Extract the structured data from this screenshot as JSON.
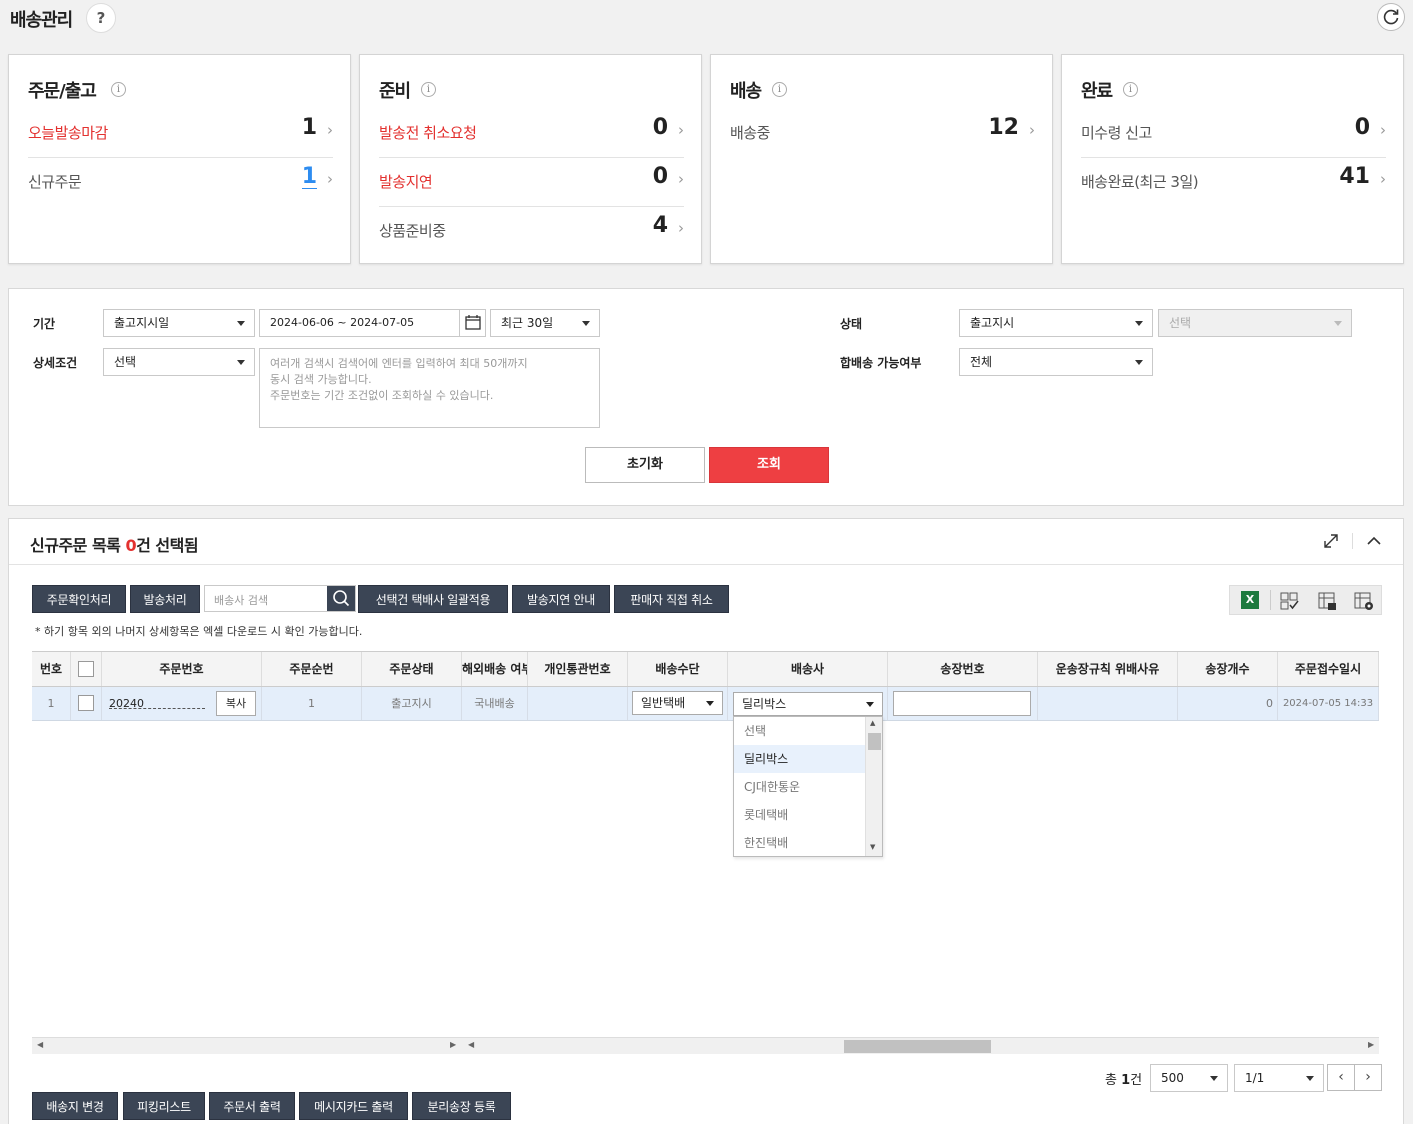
{
  "page": {
    "title": "배송관리",
    "help": "?"
  },
  "cards": [
    {
      "title": "주문/출고",
      "rows": [
        {
          "label": "오늘발송마감",
          "count": "1",
          "red": true
        },
        {
          "label": "신규주문",
          "count": "1",
          "blue": true
        }
      ]
    },
    {
      "title": "준비",
      "rows": [
        {
          "label": "발송전 취소요청",
          "count": "0",
          "red": true
        },
        {
          "label": "발송지연",
          "count": "0",
          "red": true
        },
        {
          "label": "상품준비중",
          "count": "4"
        }
      ]
    },
    {
      "title": "배송",
      "rows": [
        {
          "label": "배송중",
          "count": "12"
        }
      ]
    },
    {
      "title": "완료",
      "rows": [
        {
          "label": "미수령 신고",
          "count": "0"
        },
        {
          "label": "배송완료(최근 3일)",
          "count": "41"
        }
      ]
    }
  ],
  "search": {
    "period_label": "기간",
    "period_type": "출고지시일",
    "date_range": "2024-06-06 ~ 2024-07-05",
    "recent": "최근 30일",
    "detail_label": "상세조건",
    "detail_value": "선택",
    "detail_placeholder": "여러개 검색시 검색어에 엔터를 입력하여 최대 50개까지\n동시 검색 가능합니다.\n주문번호는 기간 조건없이 조회하실 수 있습니다.",
    "status_label": "상태",
    "status_value": "출고지시",
    "status_sub": "선택",
    "combined_label": "합배송 가능여부",
    "combined_value": "전체",
    "reset_label": "초기화",
    "search_label": "조회"
  },
  "list": {
    "title": "신규주문 목록",
    "selected_count": "0",
    "selected_suffix": "건 선택됨",
    "buttons": [
      "주문확인처리",
      "발송처리"
    ],
    "courier_search_placeholder": "배송사 검색",
    "buttons2": [
      "선택건 택배사 일괄적용",
      "발송지연 안내",
      "판매자 직접 취소"
    ],
    "note": "* 하기 항목 외의 나머지 상세항목은 엑셀 다운로드 시 확인 가능합니다.",
    "columns": [
      "번호",
      "",
      "주문번호",
      "주문순번",
      "주문상태",
      "해외배송 여부",
      "개인통관번호",
      "배송수단",
      "배송사",
      "송장번호",
      "운송장규칙 위배사유",
      "송장개수",
      "주문접수일시"
    ],
    "rows": [
      {
        "no": "1",
        "order_no": "20240",
        "copy": "복사",
        "seq": "1",
        "status": "출고지시",
        "overseas": "국내배송",
        "customs": "",
        "method": "일반택배",
        "courier": "딜리박스",
        "invoice": "",
        "violation": "",
        "invoice_count": "0",
        "received": "2024-07-05 14:33"
      }
    ],
    "courier_options": [
      "선택",
      "딜리박스",
      "CJ대한통운",
      "롯데택배",
      "한진택배"
    ],
    "courier_selected": "딜리박스",
    "total_prefix": "총",
    "total_count": "1",
    "total_suffix": "건",
    "page_size": "500",
    "page": "1/1",
    "bottom_buttons": [
      "배송지 변경",
      "피킹리스트",
      "주문서 출력",
      "메시지카드 출력",
      "분리송장 등록"
    ]
  },
  "colors": {
    "accent": "#ee3f42",
    "dark_button": "#3b4555",
    "red_text": "#e3312f",
    "blue_text": "#2d8cf0"
  }
}
